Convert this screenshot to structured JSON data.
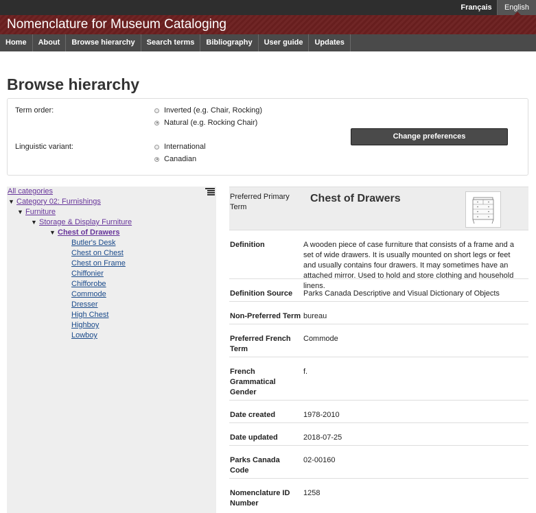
{
  "lang": {
    "fr": "Français",
    "en": "English"
  },
  "site": {
    "title": "Nomenclature for Museum Cataloging"
  },
  "nav": [
    "Home",
    "About",
    "Browse hierarchy",
    "Search terms",
    "Bibliography",
    "User guide",
    "Updates"
  ],
  "page": {
    "title": "Browse hierarchy"
  },
  "prefs": {
    "term_order_label": "Term order:",
    "term_order_options": [
      {
        "label": "Inverted (e.g. Chair, Rocking)",
        "selected": false
      },
      {
        "label": "Natural (e.g. Rocking Chair)",
        "selected": true
      }
    ],
    "variant_label": "Linguistic variant:",
    "variant_options": [
      {
        "label": "International",
        "selected": false
      },
      {
        "label": "Canadian",
        "selected": true
      }
    ],
    "change_button": "Change preferences"
  },
  "tree": {
    "root": "All categories",
    "path": [
      {
        "label": "Category 02: Furnishings"
      },
      {
        "label": "Furniture"
      },
      {
        "label": "Storage & Display Furniture"
      },
      {
        "label": "Chest of Drawers",
        "current": true
      }
    ],
    "children": [
      "Butler's Desk",
      "Chest on Chest",
      "Chest on Frame",
      "Chiffonier",
      "Chifforobe",
      "Commode",
      "Dresser",
      "High Chest",
      "Highboy",
      "Lowboy"
    ]
  },
  "detail": {
    "primary_label": "Preferred Primary Term",
    "primary_term": "Chest of Drawers",
    "rows": [
      {
        "label": "Definition",
        "value": "A wooden piece of case furniture that consists of a frame and a set of wide drawers. It is usually mounted on short legs or feet and usually contains four drawers. It may sometimes have an attached mirror. Used to hold and store clothing and household linens."
      },
      {
        "label": "Definition Source",
        "value": "Parks Canada Descriptive and Visual Dictionary of Objects"
      },
      {
        "label": "Non-Preferred Term",
        "value": "bureau"
      },
      {
        "label": "Preferred French Term",
        "value": "Commode"
      },
      {
        "label": "French Grammatical Gender",
        "value": "f."
      },
      {
        "label": "Date created",
        "value": "1978-2010"
      },
      {
        "label": "Date updated",
        "value": "2018-07-25"
      },
      {
        "label": "Parks Canada Code",
        "value": "02-00160"
      },
      {
        "label": "Nomenclature ID Number",
        "value": "1258"
      }
    ]
  }
}
